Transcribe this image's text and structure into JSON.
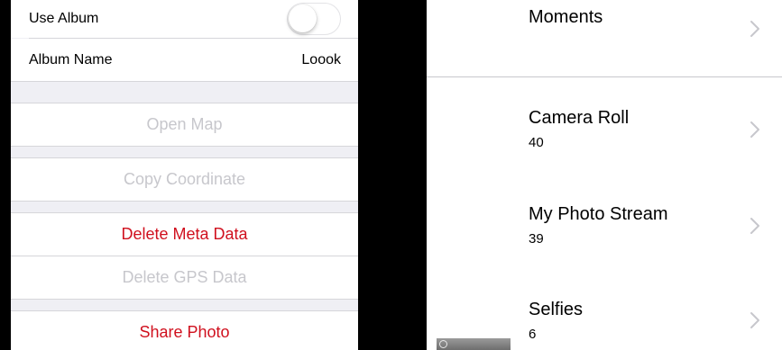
{
  "settings": {
    "use_album": {
      "label": "Use Album",
      "toggle_on": false
    },
    "album_name": {
      "label": "Album Name",
      "value": "Loook"
    }
  },
  "actions": {
    "open_map": "Open Map",
    "copy_coordinate": "Copy Coordinate",
    "delete_meta_data": "Delete Meta Data",
    "delete_gps_data": "Delete GPS Data",
    "share_photo": "Share Photo"
  },
  "albums": [
    {
      "title": "Moments",
      "count": ""
    },
    {
      "title": "Camera Roll",
      "count": "40"
    },
    {
      "title": "My Photo Stream",
      "count": "39"
    },
    {
      "title": "Selfies",
      "count": "6"
    }
  ],
  "colors": {
    "destructive": "#d0101e",
    "disabled": "#c7c7cc",
    "group_background": "#efeff4",
    "chevron": "#c7c7cc"
  },
  "icons": {
    "disclosure": "chevron-right-icon",
    "thumbnail": "photo-thumbnail"
  }
}
